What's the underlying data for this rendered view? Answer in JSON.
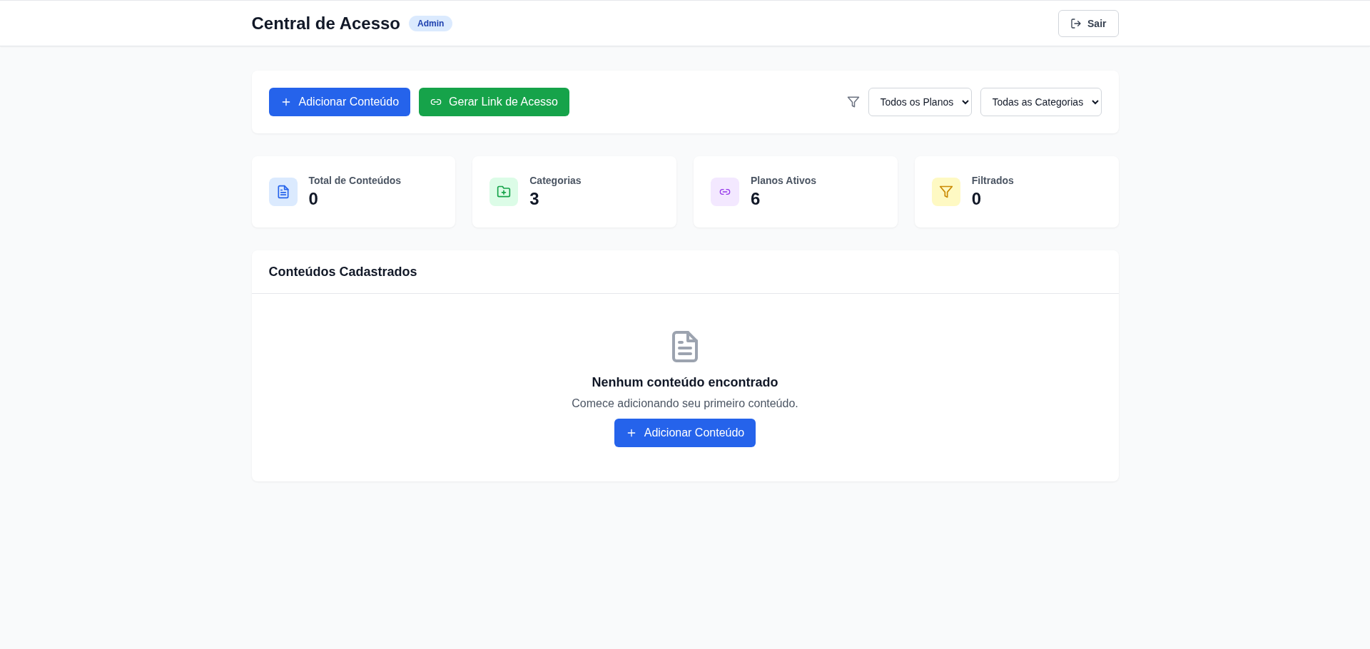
{
  "header": {
    "title": "Central de Acesso",
    "badge": "Admin",
    "logout_button": "Sair"
  },
  "toolbar": {
    "buttons": [
      {
        "kind": "add",
        "label": "Adicionar Conteúdo"
      },
      {
        "kind": "link",
        "label": "Gerar Link de Acesso"
      }
    ],
    "filters": [
      {
        "value": "Todos os Planos"
      },
      {
        "value": "Todas as Categorias"
      }
    ]
  },
  "stats": [
    {
      "kind": "document",
      "color": "#2563eb",
      "label": "Total de Conteúdos",
      "value": "0"
    },
    {
      "kind": "folder",
      "color": "#16a34a",
      "label": "Categorias",
      "value": "3"
    },
    {
      "kind": "link",
      "color": "#9333ea",
      "label": "Planos Ativos",
      "value": "6"
    },
    {
      "kind": "filter",
      "color": "#ca8a04",
      "label": "Filtrados",
      "value": "0"
    }
  ],
  "content_list": {
    "title": "Conteúdos Cadastrados",
    "empty_title": "Nenhum conteúdo encontrado",
    "empty_message": "Comece adicionando seu primeiro conteúdo.",
    "empty_button": "Adicionar Conteúdo"
  }
}
